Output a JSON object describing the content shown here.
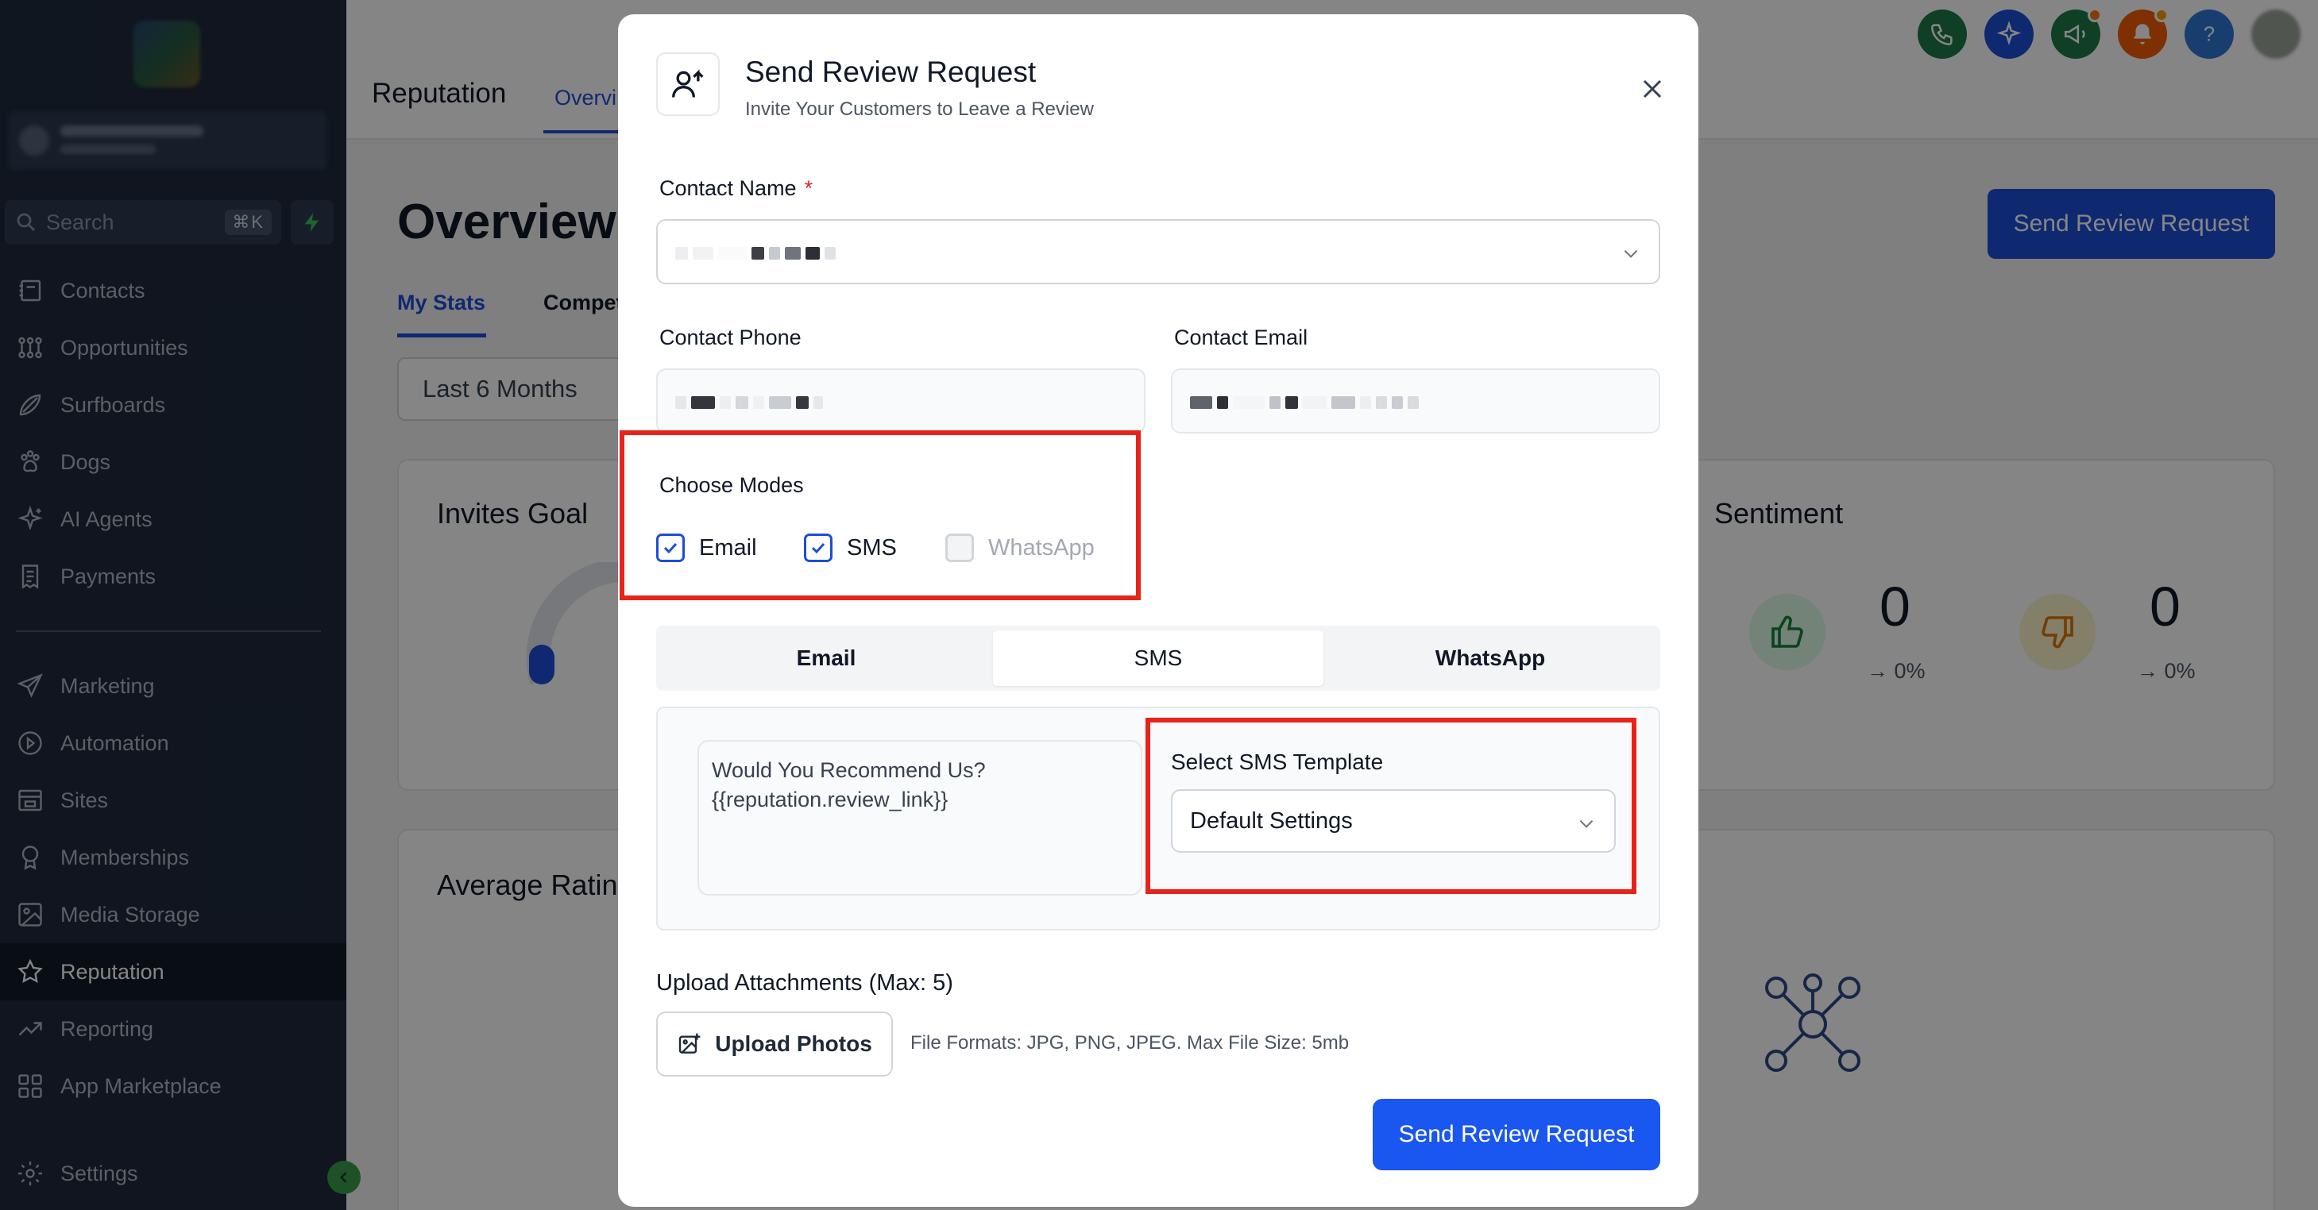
{
  "sidebar": {
    "search_label": "Search",
    "search_shortcut": "⌘K",
    "items": [
      {
        "label": "Contacts",
        "icon": "contacts-icon"
      },
      {
        "label": "Opportunities",
        "icon": "opportunities-icon"
      },
      {
        "label": "Surfboards",
        "icon": "surfboard-icon"
      },
      {
        "label": "Dogs",
        "icon": "paw-icon"
      },
      {
        "label": "AI Agents",
        "icon": "sparkle-icon"
      },
      {
        "label": "Payments",
        "icon": "receipt-icon"
      }
    ],
    "items2": [
      {
        "label": "Marketing",
        "icon": "send-icon"
      },
      {
        "label": "Automation",
        "icon": "automation-icon"
      },
      {
        "label": "Sites",
        "icon": "sites-icon"
      },
      {
        "label": "Memberships",
        "icon": "award-icon"
      },
      {
        "label": "Media Storage",
        "icon": "image-icon"
      },
      {
        "label": "Reputation",
        "icon": "star-icon",
        "active": true
      },
      {
        "label": "Reporting",
        "icon": "trend-icon"
      },
      {
        "label": "App Marketplace",
        "icon": "grid-icon"
      }
    ],
    "settings_label": "Settings"
  },
  "header": {
    "title": "Reputation",
    "tab_overview": "Overvi",
    "icons": [
      "phone-icon",
      "ai-sparkle-icon",
      "megaphone-icon",
      "bell-icon",
      "help-icon",
      "avatar"
    ]
  },
  "page": {
    "heading": "Overview",
    "send_button": "Send Review Request",
    "subtab_1": "My Stats",
    "subtab_2": "Compet",
    "range": "Last 6 Months",
    "invites_goal": "Invites Goal",
    "sentiment": "Sentiment",
    "sent_positive_value": "0",
    "sent_positive_pct": "→ 0%",
    "sent_negative_value": "0",
    "sent_negative_pct": "→ 0%",
    "avg_rating": "Average Ratin"
  },
  "modal": {
    "title": "Send Review Request",
    "subtitle": "Invite Your Customers to Leave a Review",
    "contact_name_label": "Contact Name",
    "required_mark": "*",
    "contact_phone_label": "Contact Phone",
    "contact_email_label": "Contact Email",
    "choose_modes_label": "Choose Modes",
    "modes": [
      {
        "label": "Email",
        "checked": true,
        "disabled": false
      },
      {
        "label": "SMS",
        "checked": true,
        "disabled": false
      },
      {
        "label": "WhatsApp",
        "checked": false,
        "disabled": true
      }
    ],
    "tabs": [
      "Email",
      "SMS",
      "WhatsApp"
    ],
    "active_tab": "SMS",
    "message_text": "Would You Recommend Us?\n{{reputation.review_link}}",
    "template_label": "Select SMS Template",
    "template_value": "Default Settings",
    "upload_label": "Upload Attachments (Max: 5)",
    "upload_button": "Upload Photos",
    "upload_note": "File Formats: JPG, PNG, JPEG. Max File Size: 5mb",
    "send_button": "Send Review Request"
  },
  "colors": {
    "sidebar_bg": "#1f2a3c",
    "primary": "#1a56f0",
    "highlight": "#e8231b"
  }
}
